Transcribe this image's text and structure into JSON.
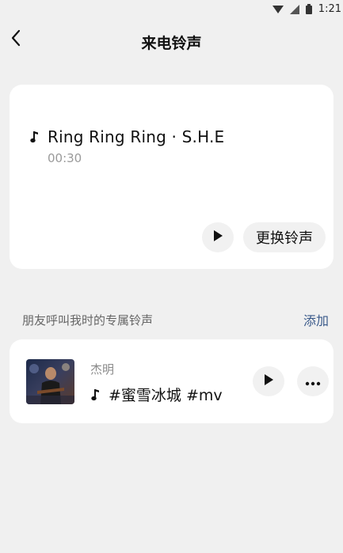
{
  "status_bar": {
    "time": "1:21",
    "icons": [
      "wifi-icon",
      "cell-signal-icon",
      "battery-icon"
    ]
  },
  "header": {
    "title": "来电铃声",
    "back_icon": "chevron-left-icon"
  },
  "current_ringtone": {
    "icon": "music-note-icon",
    "title": "Ring Ring Ring · S.H.E",
    "duration": "00:30",
    "play_icon": "play-icon",
    "change_label": "更换铃声"
  },
  "friends_section": {
    "title": "朋友呼叫我时的专属铃声",
    "add_label": "添加"
  },
  "friend_ringtone": {
    "name": "杰明",
    "song": "#蜜雪冰城 #mv",
    "note_icon": "music-note-icon",
    "play_icon": "play-icon",
    "more_icon": "more-dots-icon"
  },
  "colors": {
    "background": "#f0f0f0",
    "card": "#ffffff",
    "button_bg": "#f1f1f1",
    "link": "#3a5a8a",
    "muted_text": "#9a9a9a"
  }
}
